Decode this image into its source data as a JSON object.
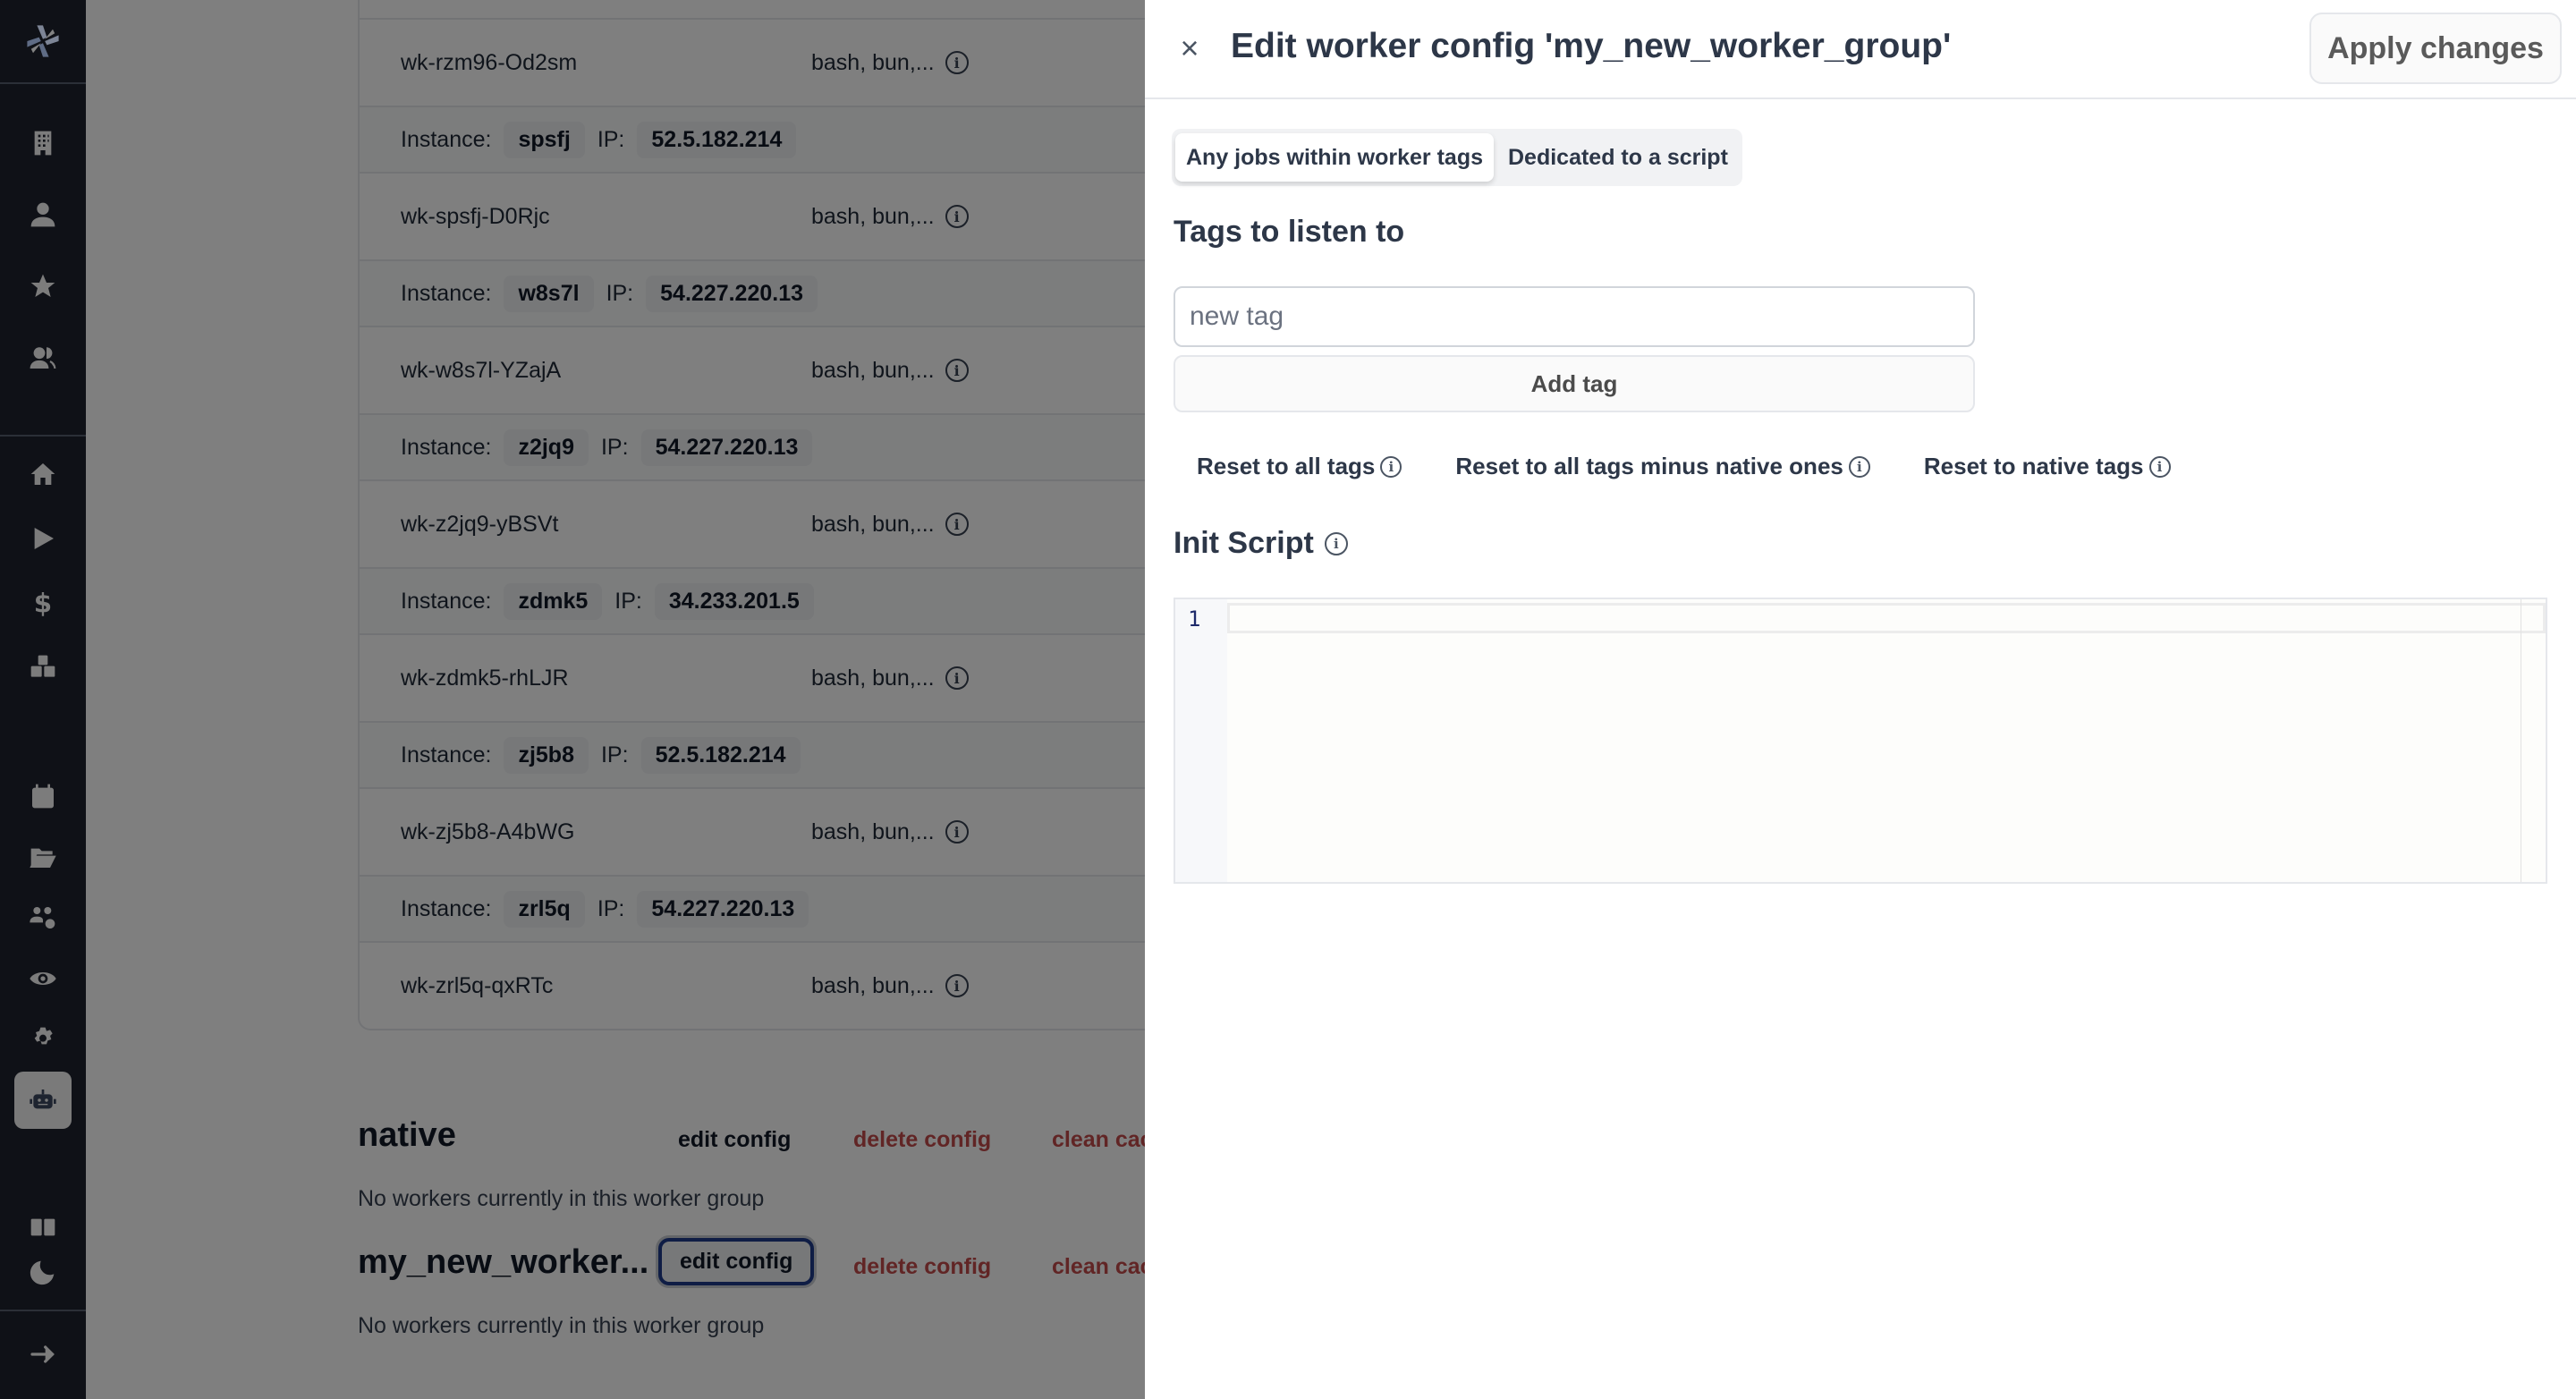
{
  "sidebar": {
    "logo": "windmill-logo-icon",
    "items": [
      {
        "icon": "building-icon",
        "label": "Workspace"
      },
      {
        "icon": "user-icon",
        "label": "User"
      },
      {
        "icon": "star-icon",
        "label": "Favorites"
      },
      {
        "icon": "users-icon",
        "label": "Groups"
      },
      {
        "icon": "home-icon",
        "label": "Home"
      },
      {
        "icon": "play-icon",
        "label": "Runs"
      },
      {
        "icon": "dollar-icon",
        "label": "Variables"
      },
      {
        "icon": "cubes-icon",
        "label": "Resources"
      },
      {
        "icon": "calendar-icon",
        "label": "Schedules"
      },
      {
        "icon": "folder-icon",
        "label": "Folders"
      },
      {
        "icon": "users-gear-icon",
        "label": "Groups settings"
      },
      {
        "icon": "eye-icon",
        "label": "Audit logs"
      },
      {
        "icon": "gear-icon",
        "label": "Settings"
      },
      {
        "icon": "robot-icon",
        "label": "Workers",
        "active": true
      },
      {
        "icon": "book-icon",
        "label": "Docs"
      },
      {
        "icon": "moon-icon",
        "label": "Dark mode"
      },
      {
        "icon": "arrow-right-icon",
        "label": "Expand"
      }
    ]
  },
  "workers": {
    "rows": [
      {
        "name": "wk-rzm96-Od2sm",
        "langs": "bash, bun,..."
      },
      {
        "instance": "spsfj",
        "ip": "52.5.182.214"
      },
      {
        "name": "wk-spsfj-D0Rjc",
        "langs": "bash, bun,..."
      },
      {
        "instance": "w8s7l",
        "ip": "54.227.220.13"
      },
      {
        "name": "wk-w8s7l-YZajA",
        "langs": "bash, bun,..."
      },
      {
        "instance": "z2jq9",
        "ip": "54.227.220.13"
      },
      {
        "name": "wk-z2jq9-yBSVt",
        "langs": "bash, bun,..."
      },
      {
        "instance": "zdmk5",
        "ip": "34.233.201.5"
      },
      {
        "name": "wk-zdmk5-rhLJR",
        "langs": "bash, bun,..."
      },
      {
        "instance": "zj5b8",
        "ip": "52.5.182.214"
      },
      {
        "name": "wk-zj5b8-A4bWG",
        "langs": "bash, bun,..."
      },
      {
        "instance": "zrl5q",
        "ip": "54.227.220.13"
      },
      {
        "name": "wk-zrl5q-qxRTc",
        "langs": "bash, bun,..."
      }
    ],
    "instance_label": "Instance:",
    "ip_label": "IP:"
  },
  "groups": [
    {
      "name": "native",
      "edit": "edit config",
      "delete": "delete config",
      "clean": "clean cac",
      "empty": "No workers currently in this worker group"
    },
    {
      "name": "my_new_worker...",
      "edit": "edit config",
      "delete": "delete config",
      "clean": "clean cac",
      "empty": "No workers currently in this worker group"
    }
  ],
  "drawer": {
    "close": "×",
    "title": "Edit worker config 'my_new_worker_group'",
    "apply": "Apply changes",
    "modes": [
      "Any jobs within worker tags",
      "Dedicated to a script"
    ],
    "active_mode": "Any jobs within worker tags",
    "tags_title": "Tags to listen to",
    "tag_input_placeholder": "new tag",
    "tag_input_value": "",
    "add_tag": "Add tag",
    "reset_buttons": [
      "Reset to all tags",
      "Reset to all tags minus native ones",
      "Reset to native tags"
    ],
    "init_script_title": "Init Script",
    "editor": {
      "line_numbers": [
        "1"
      ],
      "content": ""
    }
  }
}
